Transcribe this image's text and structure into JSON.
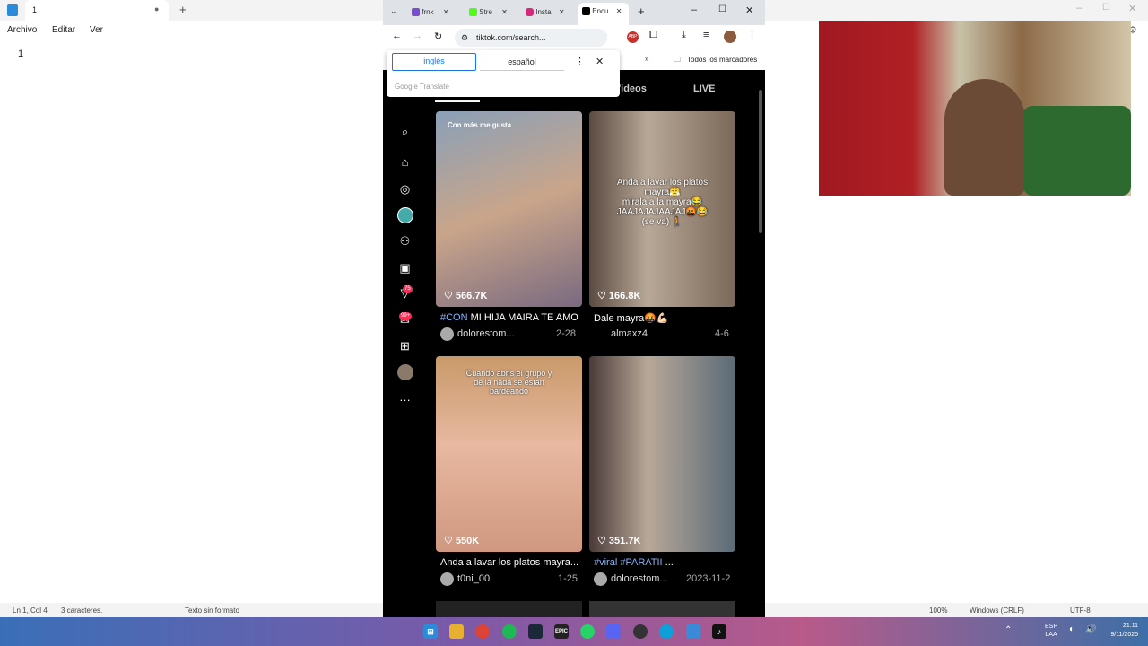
{
  "notepad": {
    "tab_title": "1",
    "menu": [
      "Archivo",
      "Editar",
      "Ver"
    ],
    "content": "1",
    "status": {
      "position": "Ln 1, Col 4",
      "chars": "3 caracteres.",
      "format": "Texto sin formato",
      "zoom": "100%",
      "eol": "Windows (CRLF)",
      "encoding": "UTF-8"
    }
  },
  "chrome": {
    "tabs": [
      "frnk",
      "Stre",
      "Insta",
      "Encu"
    ],
    "url": "tiktok.com/search...",
    "bookmarks_label": "Todos los marcadores",
    "translate": {
      "lang_from": "inglés",
      "lang_to": "español",
      "provider": "Google Translate"
    }
  },
  "tiktok": {
    "tabs": {
      "videos": "Videos",
      "live": "LIVE"
    },
    "badges": {
      "activity": "75",
      "inbox": "99+"
    },
    "videos": [
      {
        "tag": "Con más me gusta",
        "likes": "566.7K",
        "caption_tag": "#CON",
        "caption": " MI HIJA MAIRA TE AMO",
        "author": "dolorestom...",
        "date": "2-28"
      },
      {
        "overlay": "Anda a lavar los platos\nmayra😤\nmirala a la mayra😂\nJAAJAJAJAAJAJ🤬😂\n(se va) 🚶",
        "likes": "166.8K",
        "caption": "Dale mayra🤬💪🏻",
        "author": "almaxz4",
        "date": "4-6"
      },
      {
        "overlay": "Cuando abris el grupo y\nde la nada se estan\nbardeando",
        "likes": "550K",
        "caption": "Anda a lavar los platos mayra...",
        "author": "t0ni_00",
        "date": "1-25"
      },
      {
        "likes": "351.7K",
        "caption_tag": "#viral #PARATII",
        "caption": " ...",
        "author": "dolorestom...",
        "date": "2023-11-2"
      }
    ]
  },
  "taskbar": {
    "lang_top": "ESP",
    "lang_bottom": "LAA",
    "time": "21:11",
    "date": "9/11/2025"
  },
  "colors": {
    "tiktok_red": "#fe2c55",
    "link_blue": "#8ab4f8"
  }
}
